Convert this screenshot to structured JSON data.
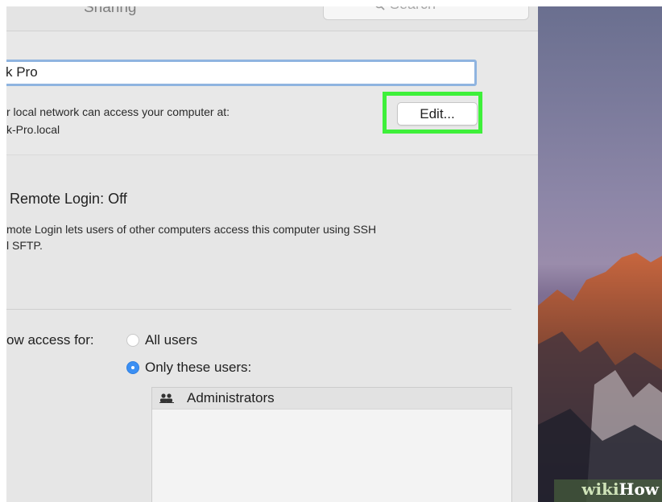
{
  "window": {
    "title": "Sharing",
    "search": {
      "placeholder": "Search",
      "icon": "search-icon"
    }
  },
  "computer_name": {
    "value": "k Pro",
    "access_line1": "r local network can access your computer at:",
    "access_line2": "k-Pro.local",
    "edit_button": "Edit...",
    "highlight_color": "#3ef03a"
  },
  "service": {
    "status_title": "Remote Login: Off",
    "description_line1": "mote Login lets users of other computers access this computer using SSH",
    "description_line2": "l SFTP."
  },
  "access": {
    "label": "ow access for:",
    "options": [
      {
        "label": "All users",
        "selected": false
      },
      {
        "label": "Only these users:",
        "selected": true
      }
    ],
    "users": [
      {
        "name": "Administrators",
        "icon": "group-icon"
      }
    ]
  },
  "watermark": {
    "part1": "wiki",
    "part2": "How"
  },
  "colors": {
    "accent": "#3b8ff3",
    "focus_ring": "#8fb4e0",
    "highlight": "#3ef03a"
  }
}
